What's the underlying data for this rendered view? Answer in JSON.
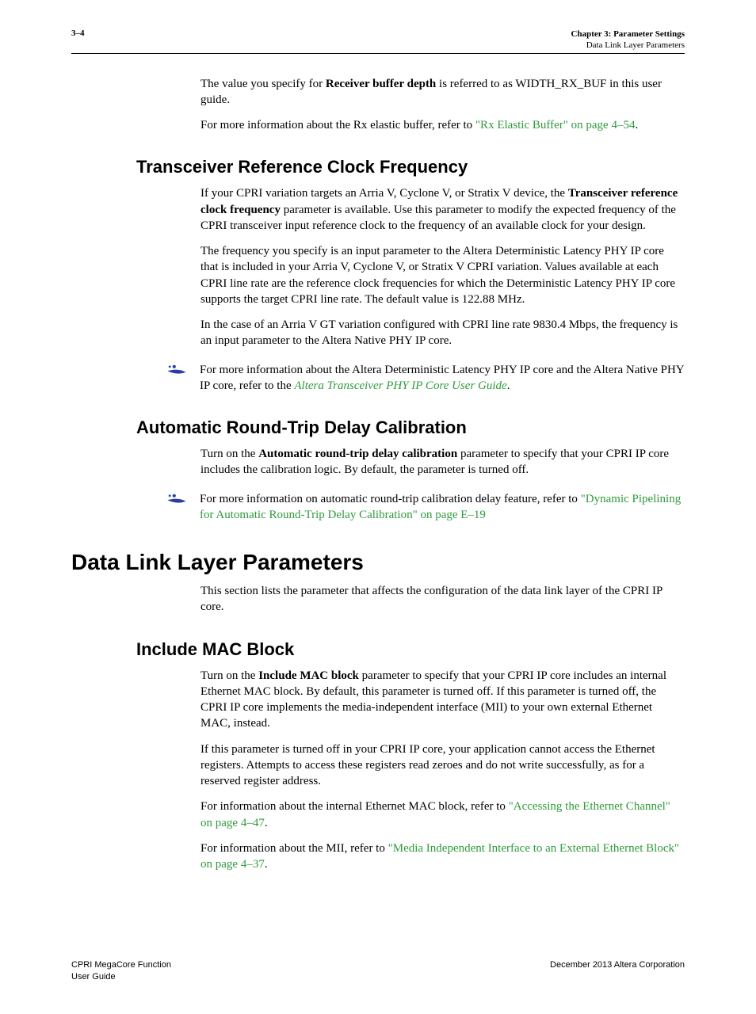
{
  "header": {
    "page_num": "3–4",
    "chapter_label": "Chapter 3:  Parameter Settings",
    "section_label": "Data Link Layer Parameters"
  },
  "p1": {
    "pre": "The value you specify for ",
    "bold": "Receiver buffer depth",
    "post": " is referred to as WIDTH_RX_BUF in this user guide."
  },
  "p2": {
    "pre": "For more information about the Rx elastic buffer, refer to ",
    "link": "\"Rx Elastic Buffer\" on page 4–54",
    "post": "."
  },
  "h_trcf": "Transceiver Reference Clock Frequency",
  "trcf_p1": {
    "pre": "If your CPRI variation targets an Arria V, Cyclone V, or Stratix V device, the ",
    "bold": "Transceiver reference clock frequency",
    "post": " parameter is available. Use this parameter to modify the expected frequency of the CPRI transceiver input reference clock to the frequency of an available clock for your design."
  },
  "trcf_p2": "The frequency you specify is an input parameter to the Altera Deterministic Latency PHY IP core that is included in your Arria V, Cyclone V, or Stratix V CPRI variation. Values available at each CPRI line rate are the reference clock frequencies for which the Deterministic Latency PHY IP core supports the target CPRI line rate. The default value is 122.88 MHz.",
  "trcf_p3": "In the case of an Arria V GT variation configured with CPRI line rate 9830.4 Mbps, the frequency is an input parameter to the Altera Native PHY IP core.",
  "trcf_note": {
    "pre": "For more information about the Altera Deterministic Latency PHY IP core and the Altera Native PHY IP core, refer to the ",
    "link": "Altera Transceiver PHY IP Core User Guide",
    "post": "."
  },
  "h_artdc": "Automatic Round-Trip Delay Calibration",
  "artdc_p1": {
    "pre": "Turn on the ",
    "bold": "Automatic round-trip delay calibration",
    "post": " parameter to specify that your CPRI IP core includes the calibration logic. By default, the parameter is turned off."
  },
  "artdc_note": {
    "pre": "For more information on automatic round-trip calibration delay feature, refer to ",
    "link": "\"Dynamic Pipelining for Automatic Round-Trip Delay Calibration\" on page E–19"
  },
  "h_dll": "Data Link Layer Parameters",
  "dll_p1": "This section lists the parameter that affects the configuration of the data link layer of the CPRI IP core.",
  "h_mac": "Include MAC Block",
  "mac_p1": {
    "pre": "Turn on the ",
    "bold": "Include MAC block",
    "post": " parameter to specify that your CPRI IP core includes an internal Ethernet MAC block. By default, this parameter is turned off. If this parameter is turned off, the CPRI IP core implements the media-independent interface (MII) to your own external Ethernet MAC, instead."
  },
  "mac_p2": "If this parameter is turned off in your CPRI IP core, your application cannot access the Ethernet registers. Attempts to access these registers read zeroes and do not write successfully, as for a reserved register address.",
  "mac_p3": {
    "pre": "For information about the internal Ethernet MAC block, refer to ",
    "link": "\"Accessing the Ethernet Channel\" on page 4–47",
    "post": "."
  },
  "mac_p4": {
    "pre": "For information about the MII, refer to ",
    "link": "\"Media Independent Interface to an External Ethernet Block\" on page 4–37",
    "post": "."
  },
  "footer": {
    "left1": "CPRI MegaCore Function",
    "left2": "User Guide",
    "right": "December 2013   Altera Corporation"
  }
}
